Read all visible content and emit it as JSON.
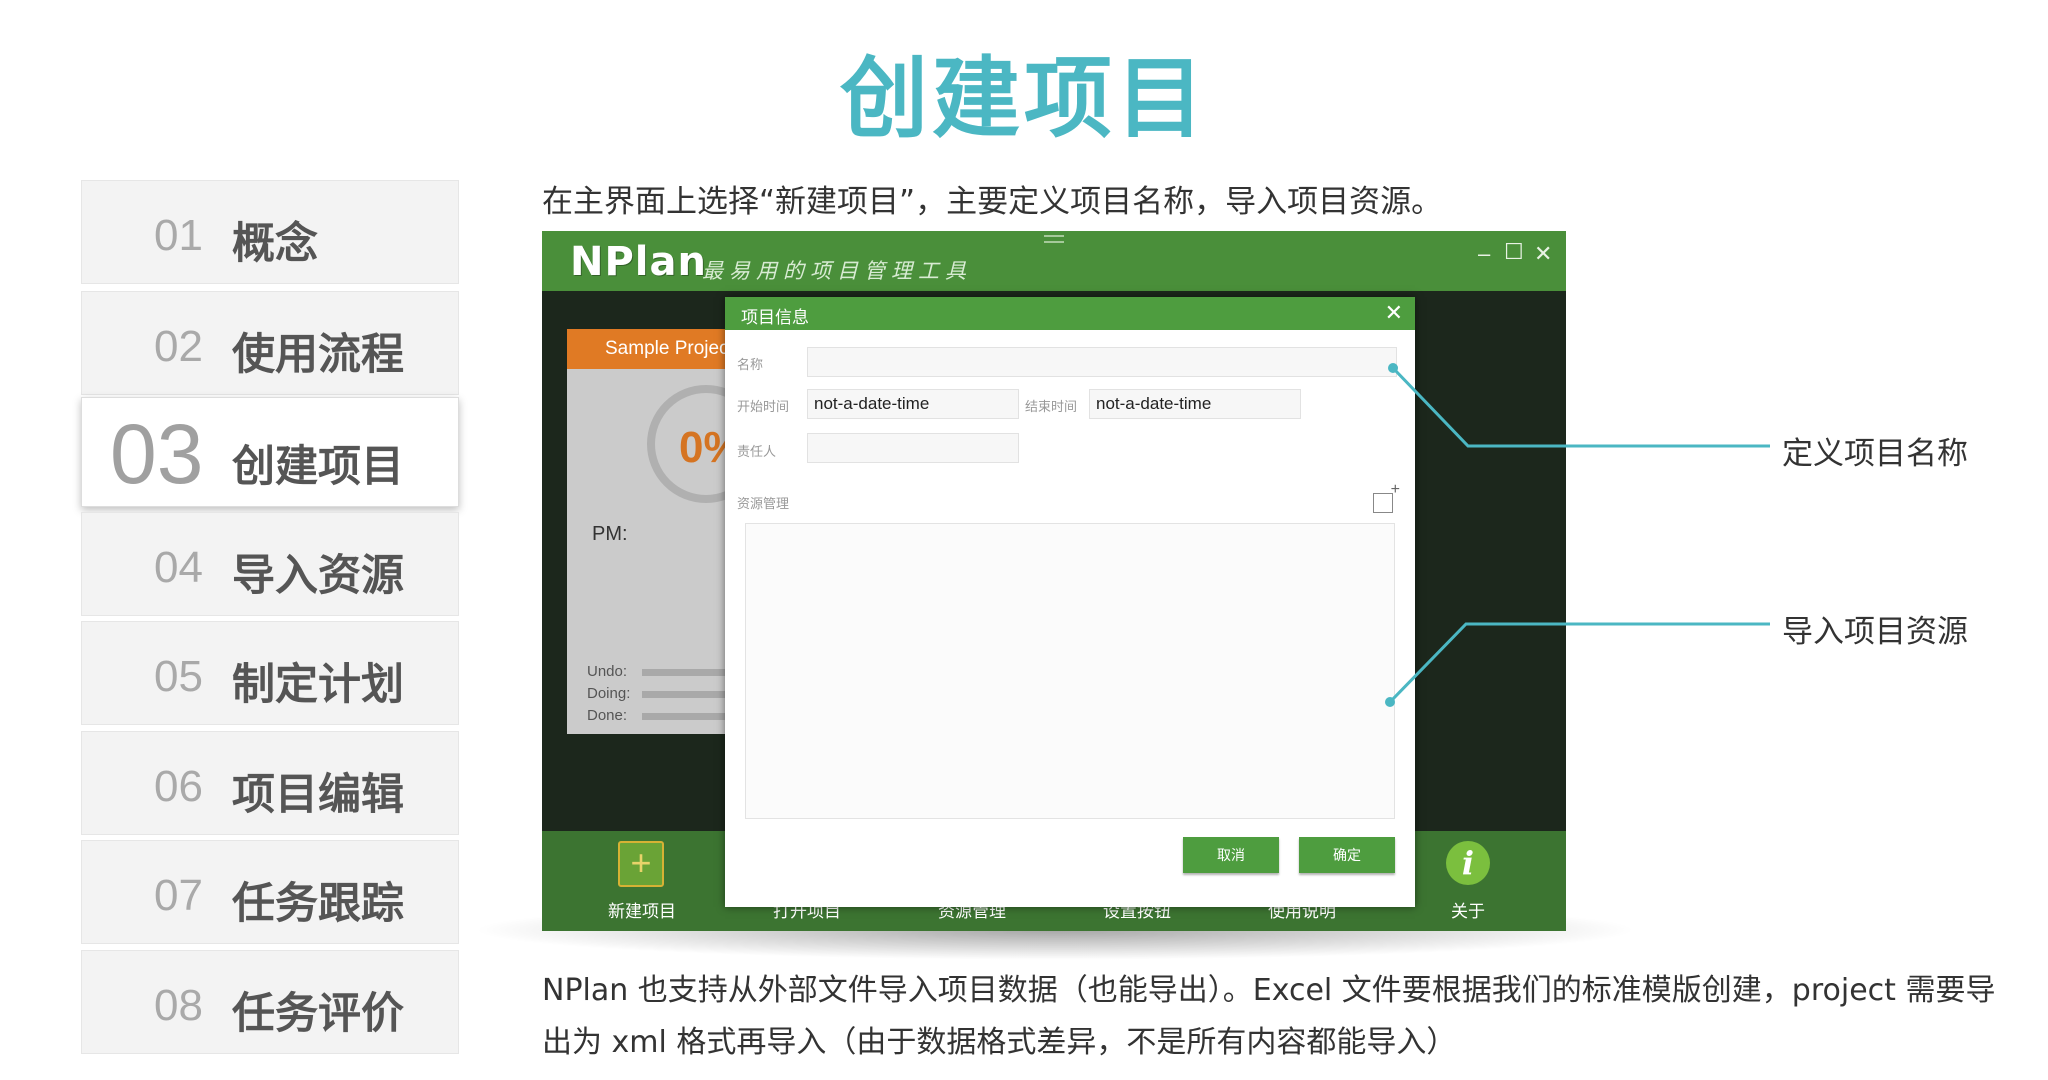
{
  "page_title": "创建项目",
  "nav": [
    {
      "num": "01",
      "label": "概念"
    },
    {
      "num": "02",
      "label": "使用流程"
    },
    {
      "num": "03",
      "label": "创建项目"
    },
    {
      "num": "04",
      "label": "导入资源"
    },
    {
      "num": "05",
      "label": "制定计划"
    },
    {
      "num": "06",
      "label": "项目编辑"
    },
    {
      "num": "07",
      "label": "任务跟踪"
    },
    {
      "num": "08",
      "label": "任务评价"
    }
  ],
  "intro": "在主界面上选择“新建项目”，主要定义项目名称，导入项目资源。",
  "app": {
    "logo": "NPlan",
    "slogan": "最易用的项目管理工具",
    "window_controls": {
      "minimize": "–",
      "maximize": "☐",
      "close": "✕"
    },
    "card": {
      "title": "Sample Project",
      "percent": "0%",
      "pm_label": "PM:",
      "undo_label": "Undo:",
      "doing_label": "Doing:",
      "done_label": "Done:"
    },
    "toolbar": [
      "新建项目",
      "打开项目",
      "资源管理",
      "设置按钮",
      "使用说明",
      "关于"
    ]
  },
  "dialog": {
    "title": "项目信息",
    "close": "✕",
    "name_label": "名称",
    "name_value": "",
    "start_label": "开始时间",
    "start_value": "not-a-date-time",
    "end_label": "结束时间",
    "end_value": "not-a-date-time",
    "owner_label": "责任人",
    "owner_value": "",
    "resource_label": "资源管理",
    "cancel": "取消",
    "ok": "确定"
  },
  "callouts": {
    "name": "定义项目名称",
    "resources": "导入项目资源"
  },
  "footer": "NPlan 也支持从外部文件导入项目数据（也能导出）。Excel 文件要根据我们的标准模版创建，project 需要导出为 xml 格式再导入（由于数据格式差异，不是所有内容都能导入）",
  "colors": {
    "title": "#4bb7c3",
    "app_green": "#4a8f3a",
    "callout_line": "#4bb7c3",
    "card_orange": "#e07a24"
  }
}
